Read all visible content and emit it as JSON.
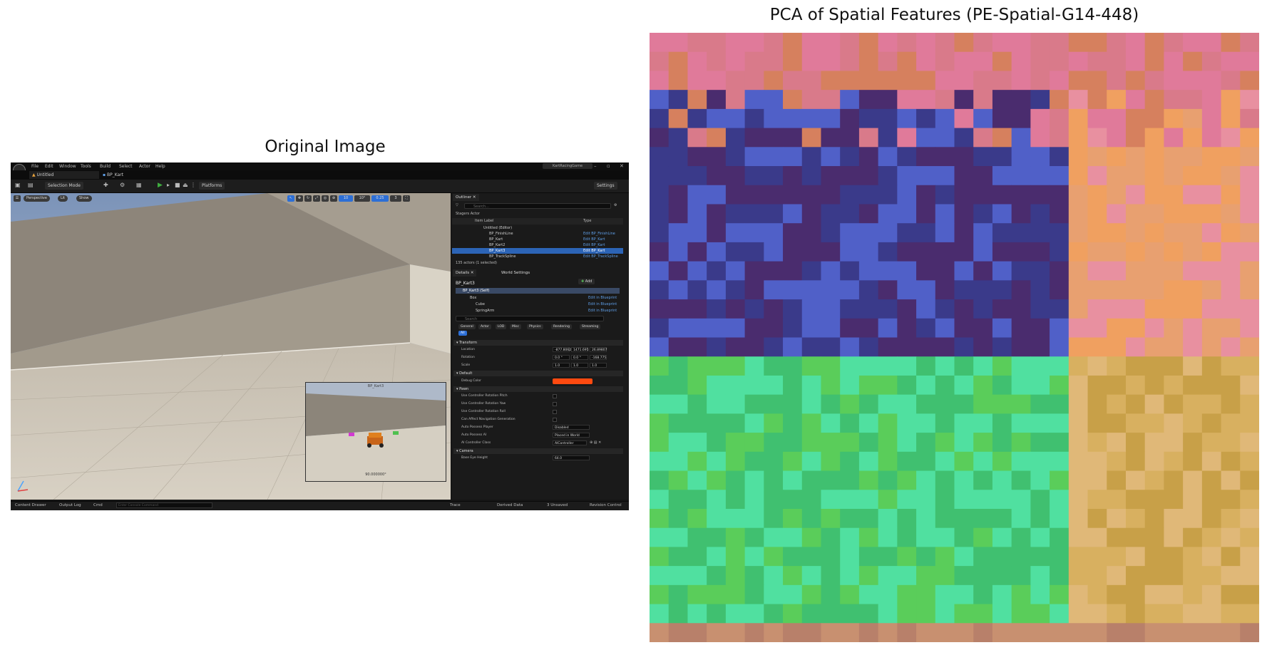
{
  "figure": {
    "left_title": "Original Image",
    "right_title": "PCA of Spatial Features (PE-Spatial-G14-448)"
  },
  "editor": {
    "menu": [
      "File",
      "Edit",
      "Window",
      "Tools",
      "Build",
      "Select",
      "Actor",
      "Help"
    ],
    "project_name": "KartRacingGame",
    "window_controls": [
      "–",
      "▫",
      "✕"
    ],
    "tabs": [
      "Untitled",
      "BP_Kart"
    ],
    "toolbar": {
      "selection_mode": "Selection Mode",
      "platforms": "Platforms",
      "settings": "Settings"
    },
    "viewport": {
      "perspective": "Perspective",
      "lit": "Lit",
      "show": "Show",
      "grid_snap": "10",
      "rot_snap": "10°",
      "scale_snap": "0.25",
      "camera_speed": "3",
      "pip_label": "BP_Kart3",
      "pip_fov": "90.000000°"
    },
    "outliner": {
      "tab": "Outliner",
      "search_placeholder": "Search...",
      "filter": "Stagers Actor",
      "col_label": "Item Label",
      "col_type": "Type",
      "rows": [
        {
          "label": "Untitled (Editor)",
          "type": ""
        },
        {
          "label": "BP_FinishLine",
          "type": "Edit BP_FinishLine"
        },
        {
          "label": "BP_Kart",
          "type": "Edit BP_Kart"
        },
        {
          "label": "BP_Kart2",
          "type": "Edit BP_Kart"
        },
        {
          "label": "BP_Kart3",
          "type": "Edit BP_Kart"
        },
        {
          "label": "BP_TrackSpline",
          "type": "Edit BP_TrackSpline"
        }
      ],
      "count": "135 actors (1 selected)"
    },
    "details": {
      "tab": "Details",
      "world_tab": "World Settings",
      "actor_name": "BP_Kart3",
      "add_label": "Add",
      "components": [
        {
          "label": "BP_Kart3 (Self)",
          "link": ""
        },
        {
          "label": "Box",
          "link": "Edit in Blueprint"
        },
        {
          "label": "Cube",
          "link": "Edit in Blueprint"
        },
        {
          "label": "SpringArm",
          "link": "Edit in Blueprint"
        }
      ],
      "search_placeholder": "Search",
      "categories": [
        "General",
        "Actor",
        "LOD",
        "Misc",
        "Physics",
        "Rendering",
        "Streaming",
        "All"
      ],
      "transform_header": "Transform",
      "location_label": "Location",
      "location_values": [
        "-877.8062",
        "1471.695",
        "26.89807"
      ],
      "rotation_label": "Rotation",
      "rotation_values": [
        "0.0 °",
        "0.0 °",
        "-168.775"
      ],
      "scale_label": "Scale",
      "scale_values": [
        "1.0",
        "1.0",
        "1.0"
      ],
      "default_header": "Default",
      "debug_color_label": "Debug Color",
      "debug_color": "#ff4a10",
      "pawn_header": "Pawn",
      "pawn_props": [
        "Use Controller Rotation Pitch",
        "Use Controller Rotation Yaw",
        "Use Controller Rotation Roll",
        "Can Affect Navigation Generation"
      ],
      "auto_possess_player_label": "Auto Possess Player",
      "auto_possess_player_value": "Disabled",
      "auto_possess_ai_label": "Auto Possess AI",
      "auto_possess_ai_value": "Placed in World",
      "ai_controller_label": "AI Controller Class",
      "ai_controller_value": "AIController",
      "camera_header": "Camera",
      "base_eye_label": "Base Eye Height",
      "base_eye_value": "64.0"
    },
    "statusbar": {
      "content_drawer": "Content Drawer",
      "output_log": "Output Log",
      "cmd": "Cmd",
      "cmd_placeholder": "Enter Console Command",
      "trace": "Trace",
      "derived_data": "Derived Data",
      "unsaved": "3 Unsaved",
      "revision": "Revision Control"
    }
  },
  "chart_data": {
    "type": "heatmap",
    "title": "PCA of Spatial Features (PE-Spatial-G14-448)",
    "grid": [
      32,
      32
    ],
    "encoding": "RGB = first three principal components",
    "regions": [
      {
        "area": "top rows (sky)",
        "colors": [
          "#d97a8a",
          "#e07a9a",
          "#d6805e"
        ]
      },
      {
        "area": "upper-left / center (wall)",
        "colors": [
          "#4a2c6e",
          "#3a3a8a",
          "#5060c8"
        ]
      },
      {
        "area": "right side (bright wall)",
        "colors": [
          "#e8a070",
          "#f0a060",
          "#e890a0"
        ]
      },
      {
        "area": "lower-left / center (floor)",
        "colors": [
          "#40c070",
          "#5acd5a",
          "#50e0a0"
        ]
      },
      {
        "area": "lower-right (inset view)",
        "colors": [
          "#d8b060",
          "#c8a048",
          "#e0b878"
        ]
      },
      {
        "area": "bottom row",
        "colors": [
          "#c89070",
          "#b8806a"
        ]
      }
    ]
  }
}
